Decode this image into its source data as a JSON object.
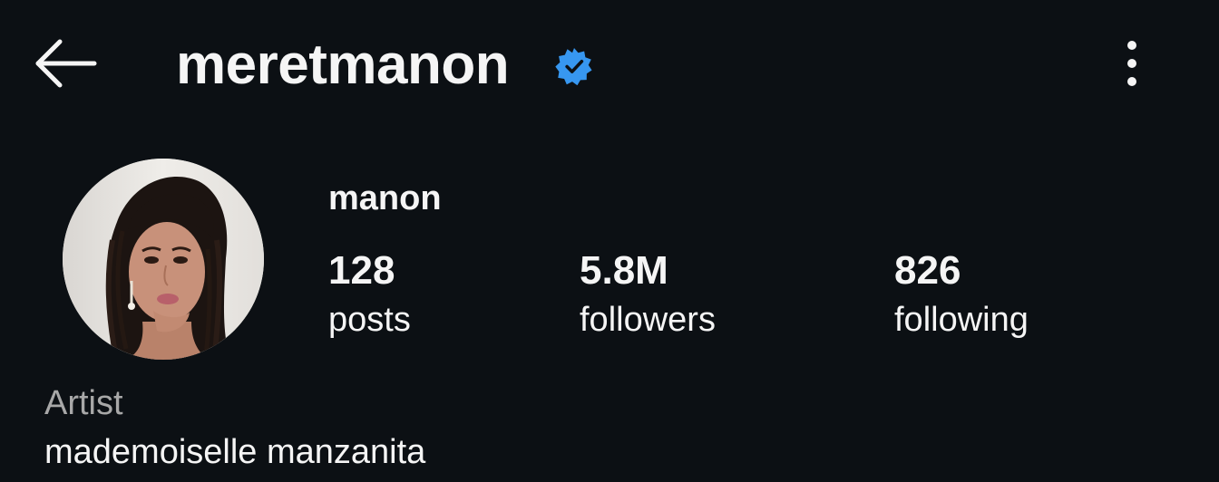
{
  "header": {
    "username": "meretmanon",
    "verified": true,
    "back_icon": "arrow-left-icon",
    "more_icon": "more-vertical-icon",
    "verified_icon": "verified-badge-icon",
    "verified_color": "#3797f0"
  },
  "profile": {
    "display_name": "manon",
    "avatar_icon": "profile-photo",
    "stats": {
      "posts_count": "128",
      "posts_label": "posts",
      "followers_count": "5.8M",
      "followers_label": "followers",
      "following_count": "826",
      "following_label": "following"
    },
    "category": "Artist",
    "bio": "mademoiselle manzanita"
  },
  "colors": {
    "background": "#0c1014",
    "text": "#f5f5f5",
    "secondary_text": "#a8a8a8"
  }
}
